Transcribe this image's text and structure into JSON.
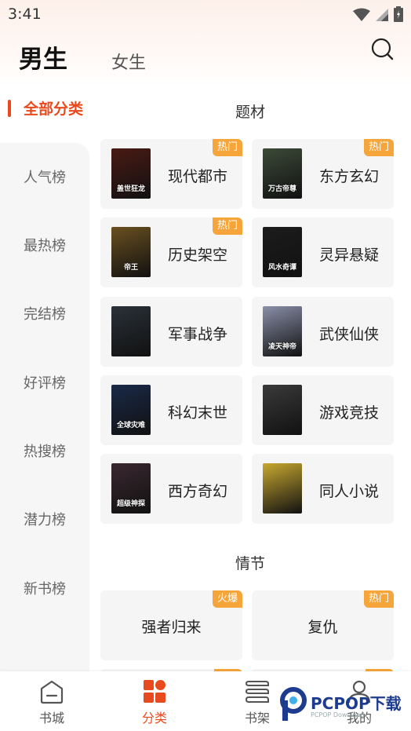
{
  "status_bar": {
    "time": "3:41"
  },
  "header": {
    "tab_male": "男生",
    "tab_female": "女生"
  },
  "sidebar": {
    "active": "全部分类",
    "items": [
      "人气榜",
      "最热榜",
      "完结榜",
      "好评榜",
      "热搜榜",
      "潜力榜",
      "新书榜"
    ]
  },
  "sections": {
    "topic_title": "题材",
    "plot_title": "情节"
  },
  "topic_cards": [
    {
      "name": "现代都市",
      "badge": "热门",
      "cover_text": "盖世狂龙",
      "cover_color": "#4a1a14"
    },
    {
      "name": "东方玄幻",
      "badge": "热门",
      "cover_text": "万古帝尊",
      "cover_color": "#3c4a38"
    },
    {
      "name": "历史架空",
      "badge": "热门",
      "cover_text": "帝王",
      "cover_color": "#6a5020"
    },
    {
      "name": "灵异悬疑",
      "badge": "",
      "cover_text": "风水奇谭",
      "cover_color": "#1c1c1c"
    },
    {
      "name": "军事战争",
      "badge": "",
      "cover_text": "",
      "cover_color": "#2a3138"
    },
    {
      "name": "武侠仙侠",
      "badge": "",
      "cover_text": "凌天神帝",
      "cover_color": "#8a8fa8"
    },
    {
      "name": "科幻末世",
      "badge": "",
      "cover_text": "全球灾难",
      "cover_color": "#1a2a48"
    },
    {
      "name": "游戏竞技",
      "badge": "",
      "cover_text": "",
      "cover_color": "#3a3a3a"
    },
    {
      "name": "西方奇幻",
      "badge": "",
      "cover_text": "超级神探",
      "cover_color": "#3a2830"
    },
    {
      "name": "同人小说",
      "badge": "",
      "cover_text": "",
      "cover_color": "#c8a830"
    }
  ],
  "plot_cards": [
    {
      "name": "强者归来",
      "badge": "火爆"
    },
    {
      "name": "复仇",
      "badge": "热门"
    }
  ],
  "bottom_nav": [
    {
      "label": "书城",
      "icon": "home-icon"
    },
    {
      "label": "分类",
      "icon": "category-icon"
    },
    {
      "label": "书架",
      "icon": "bookshelf-icon"
    },
    {
      "label": "我的",
      "icon": "profile-icon"
    }
  ],
  "watermark": {
    "text": "PCPOP下载",
    "sub": "PCPOP Download"
  },
  "colors": {
    "accent": "#e84a1e",
    "badge": "#f5a53a",
    "card_bg": "#f5f5f5"
  }
}
